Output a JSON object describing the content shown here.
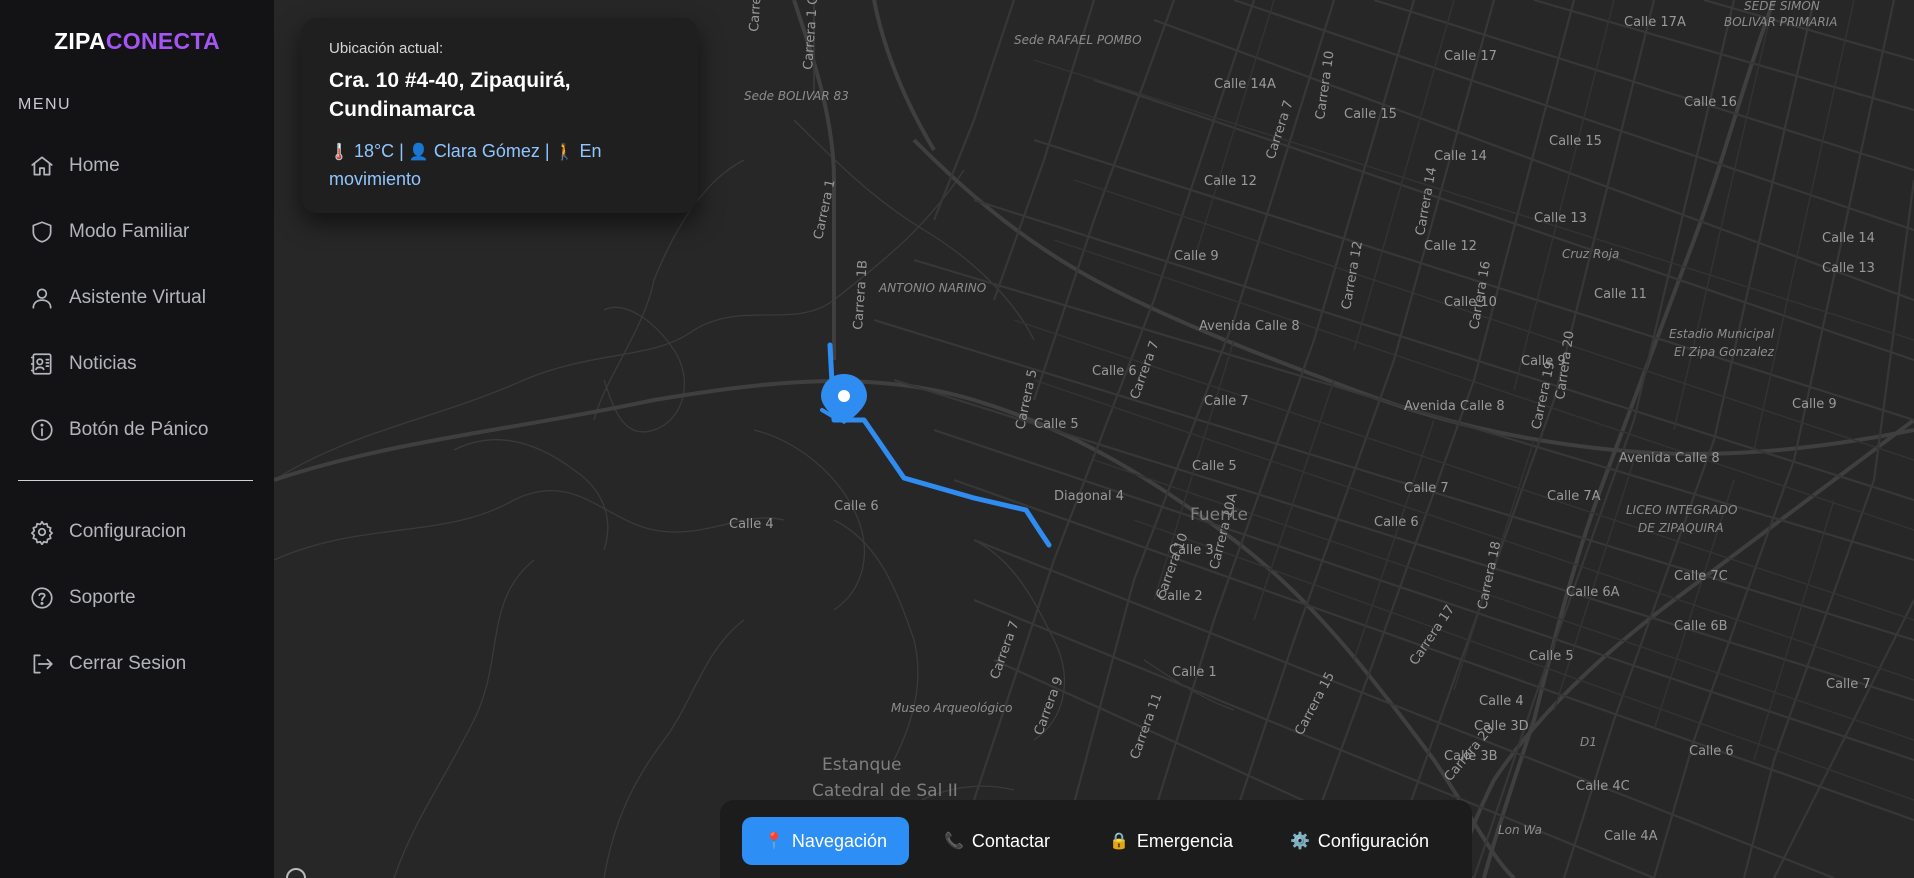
{
  "brand": {
    "part1": "ZIPA",
    "part2": "CONECTA"
  },
  "sidebar": {
    "menu_label": "MENU",
    "items": [
      {
        "label": "Home",
        "icon": "home-icon"
      },
      {
        "label": "Modo Familiar",
        "icon": "shield-icon"
      },
      {
        "label": "Asistente Virtual",
        "icon": "user-icon"
      },
      {
        "label": "Noticias",
        "icon": "contact-card-icon"
      },
      {
        "label": "Botón de Pánico",
        "icon": "info-icon"
      }
    ],
    "bottom_items": [
      {
        "label": "Configuracion",
        "icon": "gear-icon"
      },
      {
        "label": "Soporte",
        "icon": "help-icon"
      },
      {
        "label": "Cerrar Sesion",
        "icon": "logout-icon"
      }
    ]
  },
  "location_card": {
    "caption": "Ubicación actual:",
    "address_line1": "Cra. 10 #4-40, Zipaquirá,",
    "address_line2": "Cundinamarca",
    "temperature": "18°C",
    "user_name": "Clara Gómez",
    "status_line1": "En",
    "status_line2": "movimiento",
    "separator": "|"
  },
  "map": {
    "labels": [
      "Calle 17A",
      "Calle 17",
      "Calle 16",
      "Calle 15",
      "Calle 15",
      "Calle 14",
      "Calle 14",
      "Calle 14A",
      "Calle 13",
      "Calle 13",
      "Calle 12",
      "Calle 12",
      "Calle 11",
      "Calle 10",
      "Calle 9",
      "Calle 9",
      "Calle 9",
      "Calle 8",
      "Calle 7",
      "Calle 7",
      "Calle 7",
      "Calle 6",
      "Calle 6",
      "Calle 6",
      "Calle 6",
      "Calle 5",
      "Calle 5",
      "Calle 5",
      "Calle 4",
      "Calle 4",
      "Calle 3",
      "Calle 2",
      "Calle 1",
      "Calle 7C",
      "Calle 7A",
      "Calle 6A",
      "Calle 6B",
      "Calle 4C",
      "Calle 4A",
      "Calle 3B",
      "Calle 3D",
      "Carrera 1",
      "Carrera 1 Oeste",
      "Carrera 3 Oeste",
      "Carrera 1B",
      "Carrera 5",
      "Carrera 7",
      "Carrera 7",
      "Carrera 7",
      "Carrera 9",
      "Carrera 10",
      "Carrera 10",
      "Carrera 10A",
      "Carrera 11",
      "Carrera 12",
      "Carrera 14",
      "Carrera 15",
      "Carrera 16",
      "Carrera 17",
      "Carrera 18",
      "Carrera 19",
      "Carrera 20",
      "Carrera 20",
      "Avenida Calle 8",
      "Avenida Calle 8",
      "Avenida Calle 8",
      "Diagonal 4"
    ],
    "places": [
      "Sede RAFAEL POMBO",
      "Sede BOLIVAR 83",
      "SEDE SIMON BOLIVAR PRIMARIA",
      "ANTONIO NARINO",
      "Cruz Roja",
      "Estadio Municipal",
      "El Zipa Gonzalez",
      "LICEO INTEGRADO",
      "DE ZIPAQUIRA",
      "Museo Arqueológico",
      "Lon Wa",
      "D1"
    ],
    "big_labels": [
      "Fuente",
      "Estanque",
      "Catedral de Sal II"
    ],
    "route_color": "#2f8cf0",
    "pin_color": "#2f8cf0"
  },
  "actions": [
    {
      "label": "Navegación",
      "icon": "pin-icon",
      "emoji": "📍",
      "active": true
    },
    {
      "label": "Contactar",
      "icon": "phone-icon",
      "emoji": "📞",
      "active": false
    },
    {
      "label": "Emergencia",
      "icon": "lock-icon",
      "emoji": "🔒",
      "active": false
    },
    {
      "label": "Configuración",
      "icon": "gear-icon",
      "emoji": "⚙️",
      "active": false
    }
  ],
  "status_emojis": {
    "temp": "🌡️",
    "user": "👤",
    "walk": "🚶"
  },
  "colors": {
    "sidebar_bg": "#131315",
    "map_bg": "#272727",
    "accent": "#a455f2",
    "primary": "#2d8ef5",
    "status_text": "#8fc6ff"
  }
}
